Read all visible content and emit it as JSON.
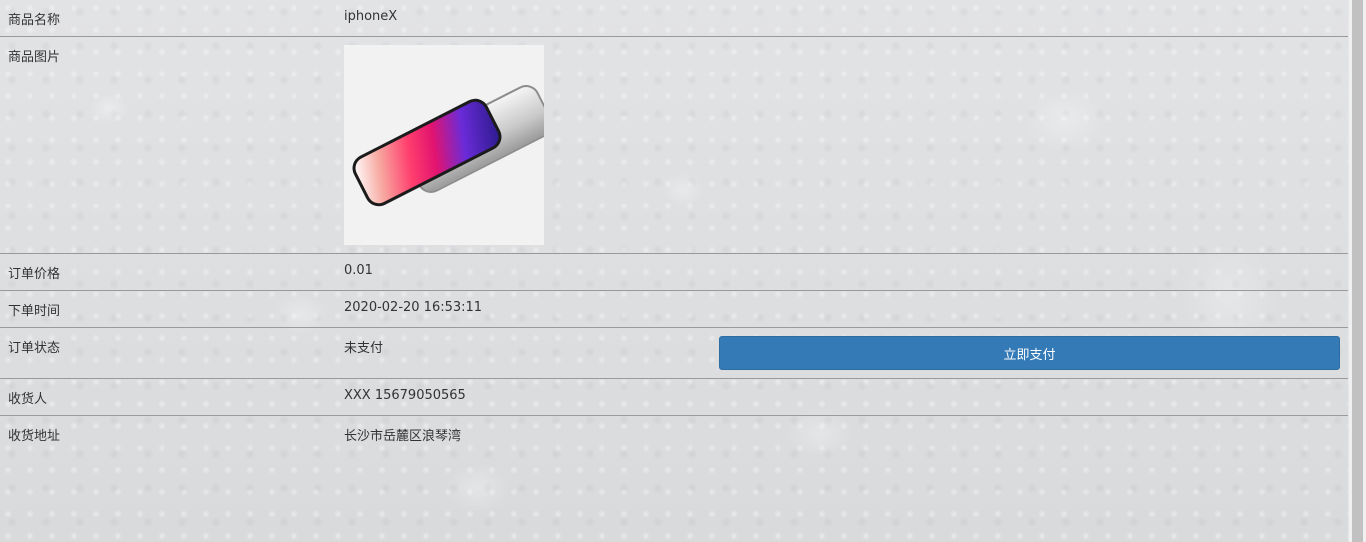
{
  "order": {
    "rows": {
      "name": {
        "label": "商品名称",
        "value": "iphoneX"
      },
      "image": {
        "label": "商品图片"
      },
      "price": {
        "label": "订单价格",
        "value": "0.01"
      },
      "time": {
        "label": "下单时间",
        "value": "2020-02-20 16:53:11"
      },
      "status": {
        "label": "订单状态",
        "value": "未支付",
        "button": "立即支付"
      },
      "receiver": {
        "label": "收货人",
        "value": "XXX 15679050565"
      },
      "address": {
        "label": "收货地址",
        "value": "长沙市岳麓区浪琴湾"
      }
    }
  },
  "colors": {
    "button_primary": "#337ab7",
    "row_divider": "#9a9a9a",
    "text": "#333333"
  },
  "icons": {
    "product_image": "iphone-x-product-photo"
  }
}
